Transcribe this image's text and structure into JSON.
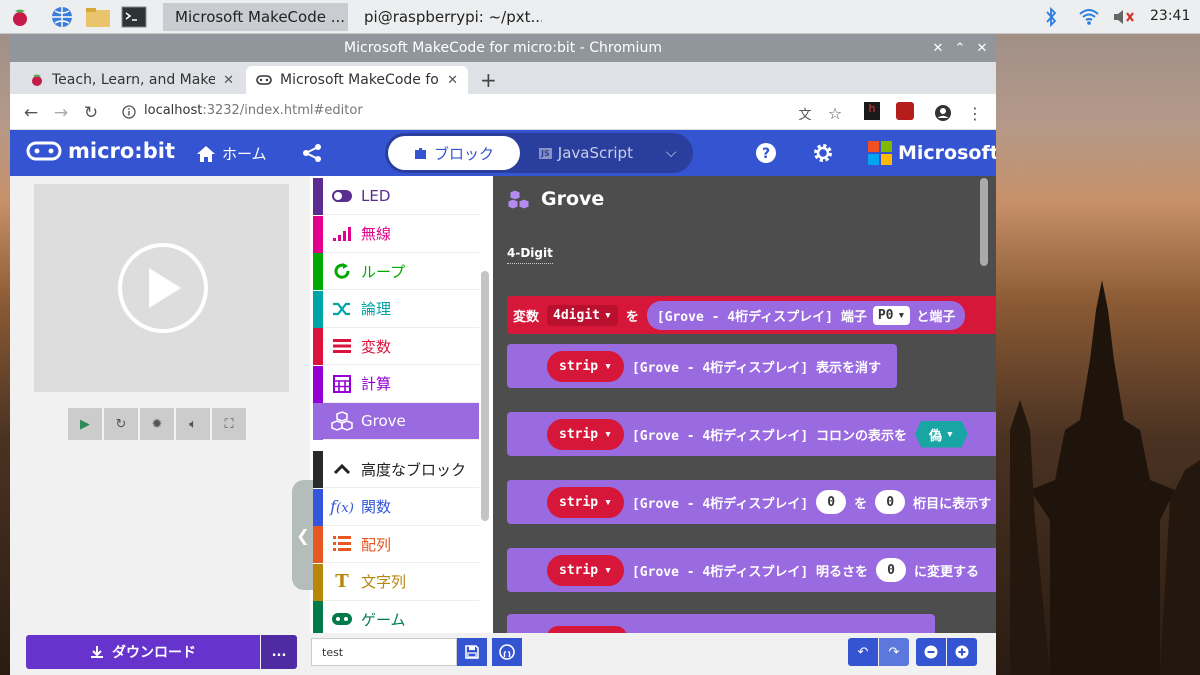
{
  "taskbar": {
    "tasks": [
      {
        "label": "Microsoft MakeCode ..."
      },
      {
        "label": "pi@raspberrypi: ~/pxt..."
      }
    ],
    "clock": "23:41"
  },
  "window": {
    "title": "Microsoft MakeCode for micro:bit - Chromium"
  },
  "browser": {
    "tabs": [
      {
        "label": "Teach, Learn, and Make with"
      },
      {
        "label": "Microsoft MakeCode for micro:bit"
      }
    ],
    "url_host": "localhost",
    "url_rest": ":3232/index.html#editor"
  },
  "header": {
    "logo": "micro:bit",
    "home": "ホーム",
    "blocks": "ブロック",
    "javascript": "JavaScript",
    "brand": "Microsoft"
  },
  "toolbox": {
    "categories": [
      {
        "label": "LED",
        "color": "#5c2d91",
        "icon": "toggle-icon"
      },
      {
        "label": "無線",
        "color": "#e3008c",
        "icon": "signal-icon"
      },
      {
        "label": "ループ",
        "color": "#00aa00",
        "icon": "loop-icon"
      },
      {
        "label": "論理",
        "color": "#00a4a6",
        "icon": "shuffle-icon"
      },
      {
        "label": "変数",
        "color": "#dc143c",
        "icon": "list-icon"
      },
      {
        "label": "計算",
        "color": "#9400d3",
        "icon": "calculator-icon"
      },
      {
        "label": "Grove",
        "color": "#9a6ae0",
        "icon": "cubes-icon"
      },
      {
        "label": "高度なブロック",
        "color": "#2a2a2a",
        "icon": "chevron-up-icon"
      },
      {
        "label": "関数",
        "color": "#3455db",
        "icon": "function-icon"
      },
      {
        "label": "配列",
        "color": "#e65722",
        "icon": "array-icon"
      },
      {
        "label": "文字列",
        "color": "#b8860b",
        "icon": "text-icon"
      },
      {
        "label": "ゲーム",
        "color": "#007a4b",
        "icon": "gamepad-icon"
      }
    ]
  },
  "flyout": {
    "title": "Grove",
    "section": "4-Digit",
    "b1": {
      "var_kw": "変数",
      "var": "4digit",
      "wo": "を",
      "text": "[Grove - 4桁ディスプレイ] 端子",
      "pin": "P0",
      "pin2": "と端子"
    },
    "strip": "strip",
    "b2": "[Grove - 4桁ディスプレイ] 表示を消す",
    "b3": {
      "text": "[Grove - 4桁ディスプレイ] コロンの表示を",
      "val": "偽"
    },
    "b4": {
      "text": "[Grove - 4桁ディスプレイ]",
      "n1": "0",
      "wo": "を",
      "n2": "0",
      "tail": "桁目に表示す"
    },
    "b5": {
      "text": "[Grove - 4桁ディスプレイ] 明るさを",
      "n": "0",
      "tail": "に変更する"
    }
  },
  "bottom": {
    "download": "ダウンロード",
    "more": "...",
    "project_name": "test"
  },
  "colors": {
    "header": "#3454d1",
    "flyout_bg": "#4d4d4d",
    "grove": "#9a6ae0",
    "variable": "#d6173a",
    "download": "#6633cc"
  }
}
